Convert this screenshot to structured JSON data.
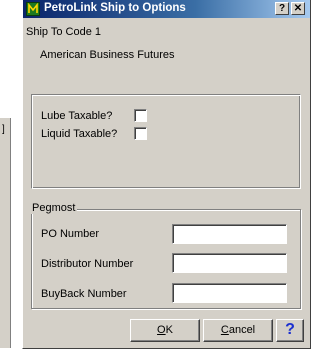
{
  "background_window": {
    "glyph": "]"
  },
  "window": {
    "title": "PetroLink Ship to Options",
    "app_icon": "petrolink-app-icon",
    "help_glyph": "?",
    "close_glyph": "✕",
    "title_gradient": [
      "#0a246a",
      "#3a6ea5",
      "#a6caf0"
    ],
    "face_color": "#d4d0c8"
  },
  "ship_to": {
    "code_text": "Ship To Code  1",
    "company_name": "American Business Futures"
  },
  "taxes": {
    "lube_label": "Lube Taxable?",
    "lube_checked": false,
    "liquid_label": "Liquid Taxable?",
    "liquid_checked": false
  },
  "pegmost": {
    "legend": "Pegmost",
    "fields": [
      {
        "label": "PO Number",
        "value": ""
      },
      {
        "label": "Distributor Number",
        "value": ""
      },
      {
        "label": "BuyBack Number",
        "value": ""
      }
    ]
  },
  "buttons": {
    "ok_mnemonic": "O",
    "ok_rest": "K",
    "cancel_mnemonic": "C",
    "cancel_rest": "ancel",
    "help_glyph": "?",
    "help_color": "#1a2fd0"
  }
}
